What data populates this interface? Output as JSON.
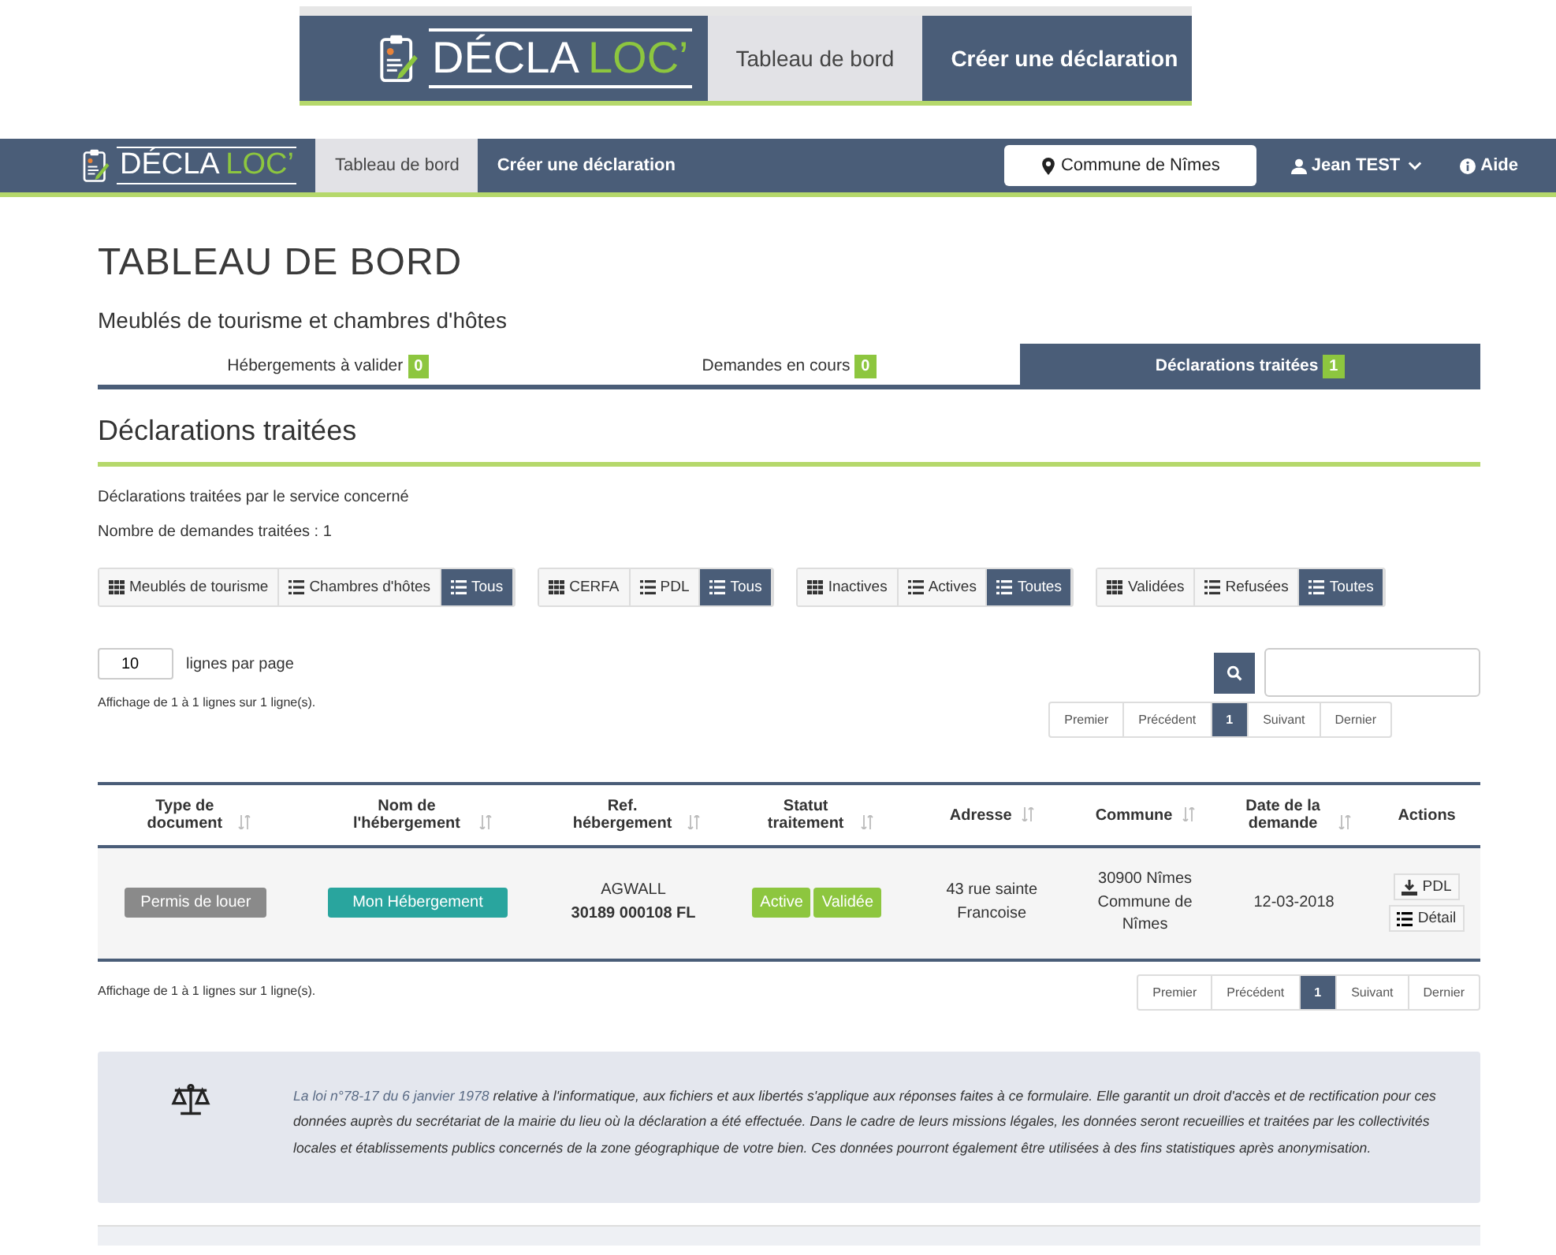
{
  "inset_header": {
    "logo": {
      "main": "DÉCLA",
      "accent": "LOC’"
    },
    "nav": [
      {
        "label": "Tableau de bord",
        "selected": true
      },
      {
        "label": "Créer une déclaration",
        "selected": false
      }
    ]
  },
  "header": {
    "logo": {
      "main": "DÉCLA",
      "accent": "LOC’"
    },
    "nav": [
      {
        "label": "Tableau de bord",
        "selected": true
      },
      {
        "label": "Créer une déclaration",
        "selected": false
      }
    ],
    "commune": "Commune de Nîmes",
    "user": "Jean TEST",
    "help": "Aide"
  },
  "page_title": "TABLEAU DE BORD",
  "subtitle": "Meublés de tourisme et chambres d'hôtes",
  "tabs": [
    {
      "label": "Hébergements à valider",
      "count": "0",
      "selected": false
    },
    {
      "label": "Demandes en cours",
      "count": "0",
      "selected": false
    },
    {
      "label": "Déclarations traitées",
      "count": "1",
      "selected": true
    }
  ],
  "section_title": "Déclarations traitées",
  "description": "Déclarations traitées par le service concerné",
  "count_text": "Nombre de demandes traitées : 1",
  "filter_groups": [
    [
      {
        "label": "Meublés de tourisme",
        "kind": "grid",
        "selected": false
      },
      {
        "label": "Chambres d'hôtes",
        "kind": "list",
        "selected": false
      },
      {
        "label": "Tous",
        "kind": "list",
        "selected": true
      }
    ],
    [
      {
        "label": "CERFA",
        "kind": "grid",
        "selected": false
      },
      {
        "label": "PDL",
        "kind": "list",
        "selected": false
      },
      {
        "label": "Tous",
        "kind": "list",
        "selected": true
      }
    ],
    [
      {
        "label": "Inactives",
        "kind": "grid",
        "selected": false
      },
      {
        "label": "Actives",
        "kind": "list",
        "selected": false
      },
      {
        "label": "Toutes",
        "kind": "list",
        "selected": true
      }
    ],
    [
      {
        "label": "Validées",
        "kind": "grid",
        "selected": false
      },
      {
        "label": "Refusées",
        "kind": "list",
        "selected": false
      },
      {
        "label": "Toutes",
        "kind": "list",
        "selected": true
      }
    ]
  ],
  "page_size": {
    "value": "10",
    "label": "lignes par page"
  },
  "info_top": "Affichage de 1 à 1 lignes sur 1 ligne(s).",
  "pagination_top": [
    {
      "label": "Premier",
      "selected": false
    },
    {
      "label": "Précédent",
      "selected": false
    },
    {
      "label": "1",
      "selected": true
    },
    {
      "label": "Suivant",
      "selected": false
    },
    {
      "label": "Dernier",
      "selected": false
    }
  ],
  "table": {
    "columns": [
      "Type de document",
      "Nom de l'hébergement",
      "Ref. hébergement",
      "Statut traitement",
      "Adresse",
      "Commune",
      "Date de la demande",
      "Actions"
    ],
    "rows": [
      {
        "type": "Permis de louer",
        "name": "Mon Hébergement",
        "ref": [
          "AGWALL",
          "30189 000108 FL"
        ],
        "status": [
          "Active",
          "Validée"
        ],
        "address": "43 rue sainte Francoise",
        "commune": [
          "30900 Nîmes",
          "Commune de",
          "Nîmes"
        ],
        "date": "12-03-2018",
        "actions": [
          "PDL",
          "Détail"
        ]
      }
    ]
  },
  "info_bottom": "Affichage de 1 à 1 lignes sur 1 ligne(s).",
  "pagination_bottom": [
    {
      "label": "Premier",
      "selected": false
    },
    {
      "label": "Précédent",
      "selected": false
    },
    {
      "label": "1",
      "selected": true
    },
    {
      "label": "Suivant",
      "selected": false
    },
    {
      "label": "Dernier",
      "selected": false
    }
  ],
  "legal": {
    "link": "La loi n°78-17 du 6 janvier 1978",
    "text": " relative à l'informatique, aux fichiers et aux libertés s'applique aux réponses faites à ce formulaire. Elle garantit un droit d'accès et de rectification pour ces données auprès du secrétariat de la mairie du lieu où la déclaration a été effectuée. Dans le cadre de leurs missions légales, les données seront recueillies et traitées par les collectivités locales et établissements publics concernés de la zone géographique de votre bien. Ces données pourront également être utilisées à des fins statistiques après anonymisation."
  }
}
